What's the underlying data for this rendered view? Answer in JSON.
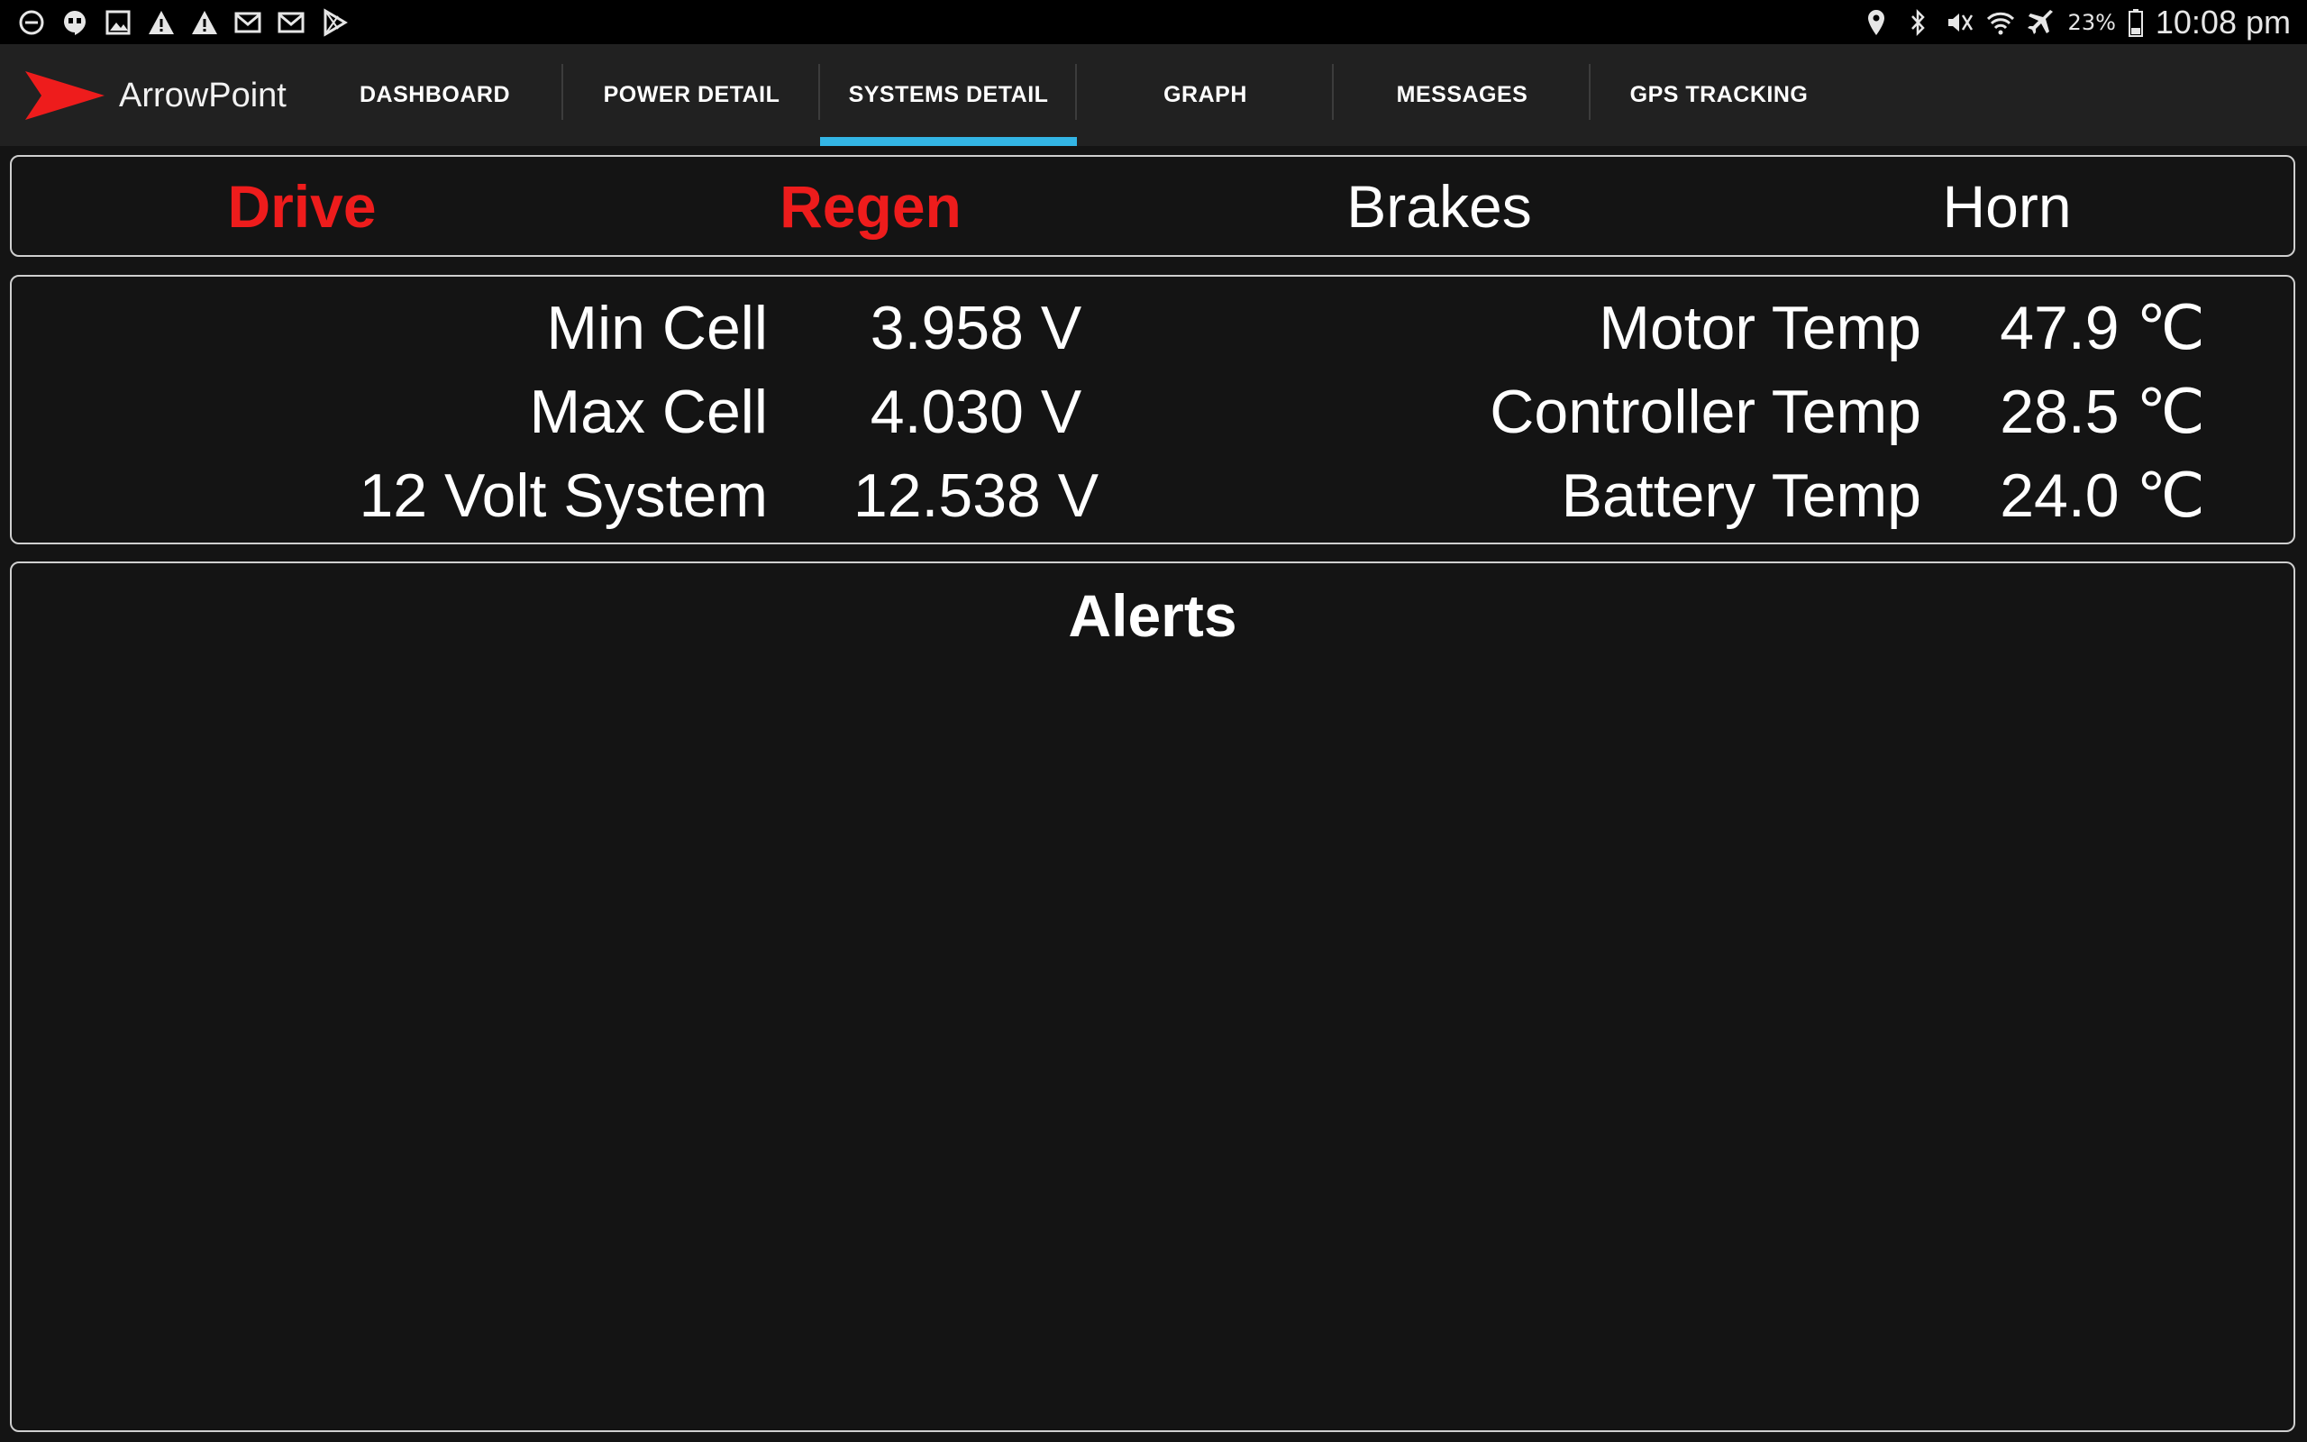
{
  "status_bar": {
    "battery_percent": "23%",
    "time": "10:08 pm",
    "left_icons": [
      "do-not-disturb-icon",
      "hangouts-icon",
      "gallery-icon",
      "warning-icon",
      "warning-icon",
      "gmail-icon",
      "gmail-icon",
      "play-store-icon"
    ],
    "right_icons": [
      "location-icon",
      "bluetooth-icon",
      "mute-icon",
      "wifi-icon",
      "airplane-icon",
      "battery-icon"
    ]
  },
  "app": {
    "name": "ArrowPoint",
    "brand_color": "#ee1c1c",
    "accent_color": "#33b5e5"
  },
  "tabs": [
    {
      "label": "DASHBOARD",
      "active": false
    },
    {
      "label": "POWER DETAIL",
      "active": false
    },
    {
      "label": "SYSTEMS DETAIL",
      "active": true
    },
    {
      "label": "GRAPH",
      "active": false
    },
    {
      "label": "MESSAGES",
      "active": false
    },
    {
      "label": "GPS TRACKING",
      "active": false
    }
  ],
  "indicators": [
    {
      "label": "Drive",
      "active": true
    },
    {
      "label": "Regen",
      "active": true
    },
    {
      "label": "Brakes",
      "active": false
    },
    {
      "label": "Horn",
      "active": false
    }
  ],
  "readings": {
    "left": [
      {
        "label": "Min Cell",
        "value": "3.958 V"
      },
      {
        "label": "Max Cell",
        "value": "4.030 V"
      },
      {
        "label": "12 Volt System",
        "value": "12.538 V"
      }
    ],
    "right": [
      {
        "label": "Motor Temp",
        "value": "47.9 ℃"
      },
      {
        "label": "Controller Temp",
        "value": "28.5 ℃"
      },
      {
        "label": "Battery Temp",
        "value": "24.0 ℃"
      }
    ]
  },
  "alerts": {
    "title": "Alerts",
    "items": []
  }
}
